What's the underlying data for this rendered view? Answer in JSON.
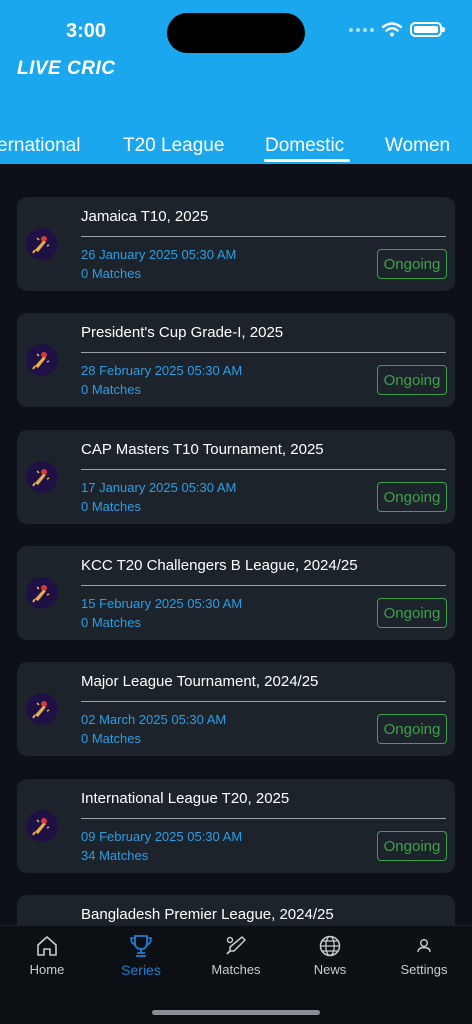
{
  "status_bar": {
    "time": "3:00"
  },
  "app": {
    "logo": "LIVE CRIC"
  },
  "tabs": [
    {
      "label": "ernational"
    },
    {
      "label": "T20 League"
    },
    {
      "label": "Domestic"
    },
    {
      "label": "Women"
    }
  ],
  "active_tab": "Domestic",
  "series": [
    {
      "title": "Jamaica T10, 2025",
      "date": "26 January 2025 05:30 AM",
      "matches": "0 Matches",
      "status": "Ongoing"
    },
    {
      "title": "President's Cup Grade-I, 2025",
      "date": "28 February 2025 05:30 AM",
      "matches": "0 Matches",
      "status": "Ongoing"
    },
    {
      "title": "CAP Masters T10 Tournament, 2025",
      "date": "17 January 2025 05:30 AM",
      "matches": "0 Matches",
      "status": "Ongoing"
    },
    {
      "title": "KCC T20 Challengers B League, 2024/25",
      "date": "15 February 2025 05:30 AM",
      "matches": "0 Matches",
      "status": "Ongoing"
    },
    {
      "title": "Major League Tournament, 2024/25",
      "date": "02 March 2025 05:30 AM",
      "matches": "0 Matches",
      "status": "Ongoing"
    },
    {
      "title": "International League T20, 2025",
      "date": "09 February 2025 05:30 AM",
      "matches": "34 Matches",
      "status": "Ongoing"
    },
    {
      "title": "Bangladesh Premier League, 2024/25",
      "date": "",
      "matches": "",
      "status": ""
    }
  ],
  "bottom_nav": [
    {
      "label": "Home",
      "icon": "home-icon"
    },
    {
      "label": "Series",
      "icon": "trophy-icon"
    },
    {
      "label": "Matches",
      "icon": "cricket-bat-icon"
    },
    {
      "label": "News",
      "icon": "globe-icon"
    },
    {
      "label": "Settings",
      "icon": "person-icon"
    }
  ],
  "colors": {
    "header": "#1aa7ee",
    "background": "#0d1117",
    "card": "#1d232b",
    "accent_blue": "#2b9ee6",
    "status_green": "#3fa04a",
    "nav_active": "#1f7fd6"
  }
}
